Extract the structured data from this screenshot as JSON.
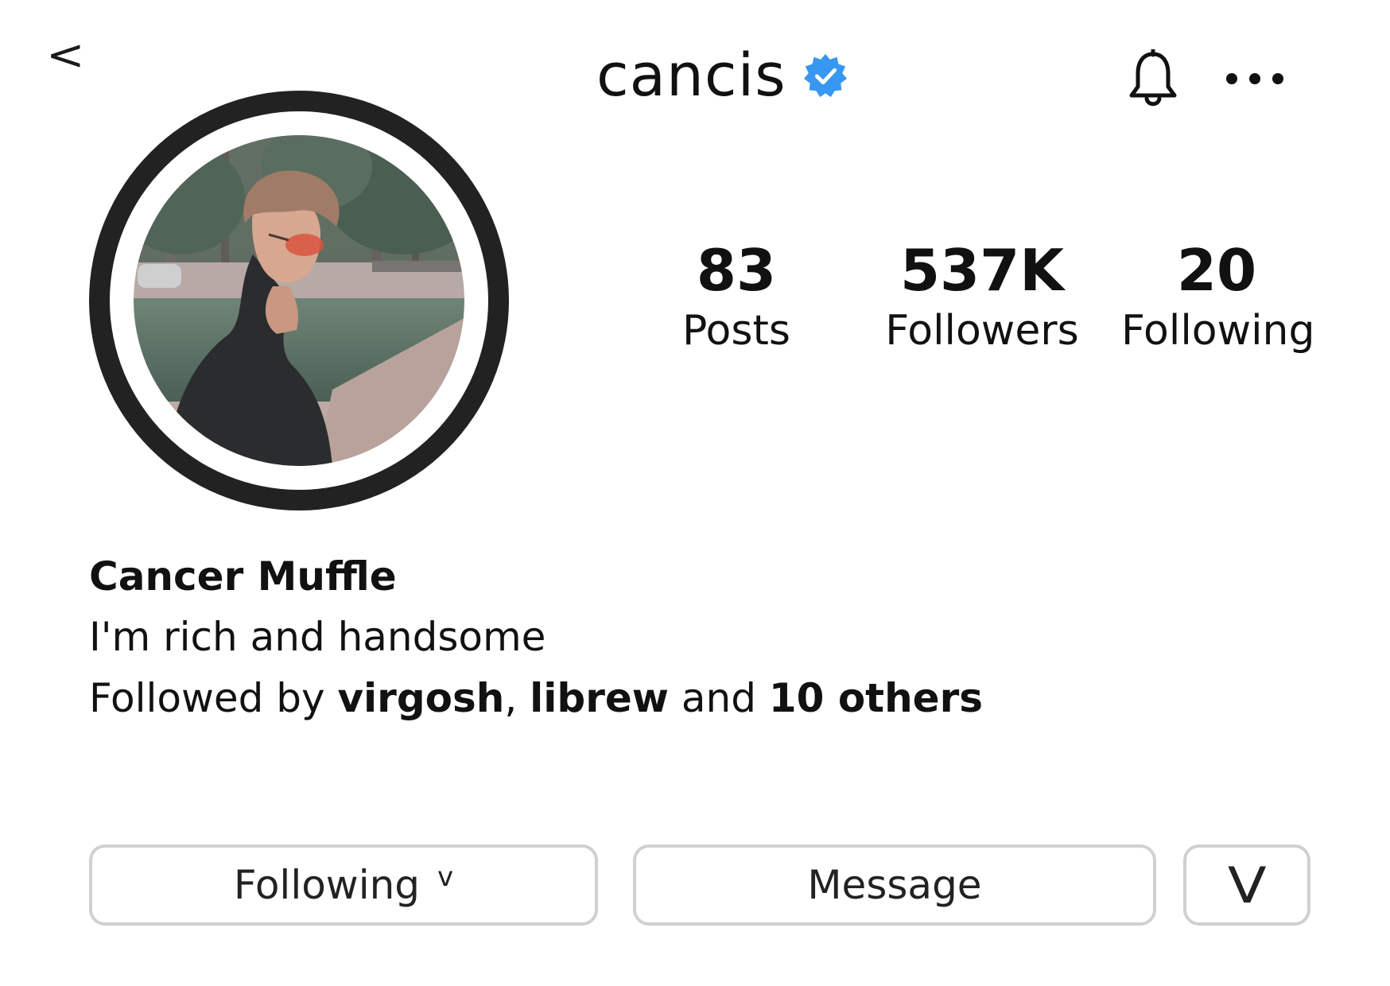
{
  "header": {
    "back_label": "<",
    "username": "cancis",
    "verified_badge": "verified-icon",
    "bell_icon": "bell-icon",
    "more_icon": "more-icon"
  },
  "stats": {
    "posts": {
      "value": "83",
      "label": "Posts"
    },
    "followers": {
      "value": "537K",
      "label": "Followers"
    },
    "following": {
      "value": "20",
      "label": "Following"
    }
  },
  "profile": {
    "display_name": "Cancer Muffle",
    "bio": "I'm rich and handsome",
    "followed_by": {
      "prefix": "Followed by ",
      "user_1": "virgosh",
      "separator": ", ",
      "user_2": "librew",
      "connector": " and ",
      "others": "10 others"
    }
  },
  "actions": {
    "following_label": "Following",
    "following_chevron": "v",
    "message_label": "Message",
    "more_label": "V"
  },
  "colors": {
    "verified_blue": "#3897f0",
    "ring": "#222222",
    "button_border": "#d0d0d0"
  }
}
